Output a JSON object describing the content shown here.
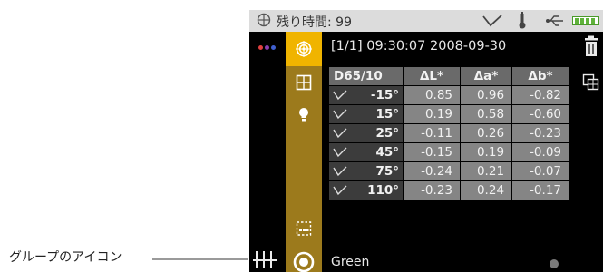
{
  "statusbar": {
    "remaining_text": "残り時間: 99",
    "icons": [
      "clock-icon",
      "wifi-icon",
      "thermometer-icon",
      "usb-icon",
      "battery-icon"
    ]
  },
  "toolbar": {
    "icons": [
      "target-icon",
      "grid-icon",
      "bulb-icon",
      "group-dashed-icon",
      "group-circle-icon"
    ],
    "accent_color": "#f0b400",
    "panel_color": "#9c7a1c"
  },
  "left_panel": {
    "led_colors": [
      "#e04040",
      "#8a3fb0",
      "#4060d0"
    ],
    "icons": [
      "dots-icon",
      "sliders-icon"
    ]
  },
  "right_panel": {
    "icons": [
      "trash-icon",
      "copy-icon"
    ]
  },
  "main": {
    "header": "[1/1] 09:30:07 2008-09-30",
    "table": {
      "columns": [
        "D65/10",
        "ΔL*",
        "Δa*",
        "Δb*"
      ],
      "rows": [
        {
          "angle": "-15°",
          "values": [
            "0.85",
            "0.96",
            "-0.82"
          ]
        },
        {
          "angle": "15°",
          "values": [
            "0.19",
            "0.58",
            "-0.60"
          ]
        },
        {
          "angle": "25°",
          "values": [
            "-0.11",
            "0.26",
            "-0.23"
          ]
        },
        {
          "angle": "45°",
          "values": [
            "-0.15",
            "0.19",
            "-0.09"
          ]
        },
        {
          "angle": "75°",
          "values": [
            "-0.24",
            "0.21",
            "-0.07"
          ]
        },
        {
          "angle": "110°",
          "values": [
            "-0.23",
            "0.24",
            "-0.17"
          ]
        }
      ]
    },
    "footer_name": "Green"
  },
  "callout": {
    "label": "グループのアイコン"
  }
}
